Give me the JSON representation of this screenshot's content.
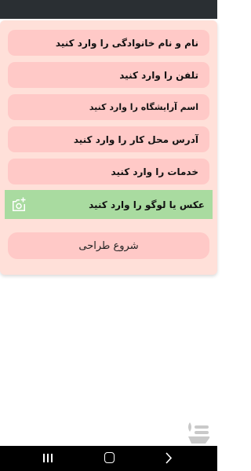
{
  "form": {
    "fields": [
      {
        "placeholder": "نام و نام خانوادگی را وارد کنید"
      },
      {
        "placeholder": "تلفن را وارد کنید"
      },
      {
        "placeholder": "اسم آرایشگاه را وارد کنید"
      },
      {
        "placeholder": "آدرس محل کار را وارد کنید"
      },
      {
        "placeholder": "خدمات را وارد کنید"
      }
    ],
    "photo_label": "عکس یا لوگو را وارد کنید",
    "start_label": "شروع طراحی"
  },
  "icons": {
    "photo": "add-photo-icon",
    "logo": "app-logo-watermark",
    "nav_recents": "recents-icon",
    "nav_home": "home-icon",
    "nav_back": "back-chevron-icon"
  },
  "colors": {
    "card_background": "#ffe0d9",
    "field_background": "#ffc9c7",
    "photo_row_background": "#a9dba0",
    "status_bar": "#2a2f33",
    "nav_bar": "#000000"
  }
}
